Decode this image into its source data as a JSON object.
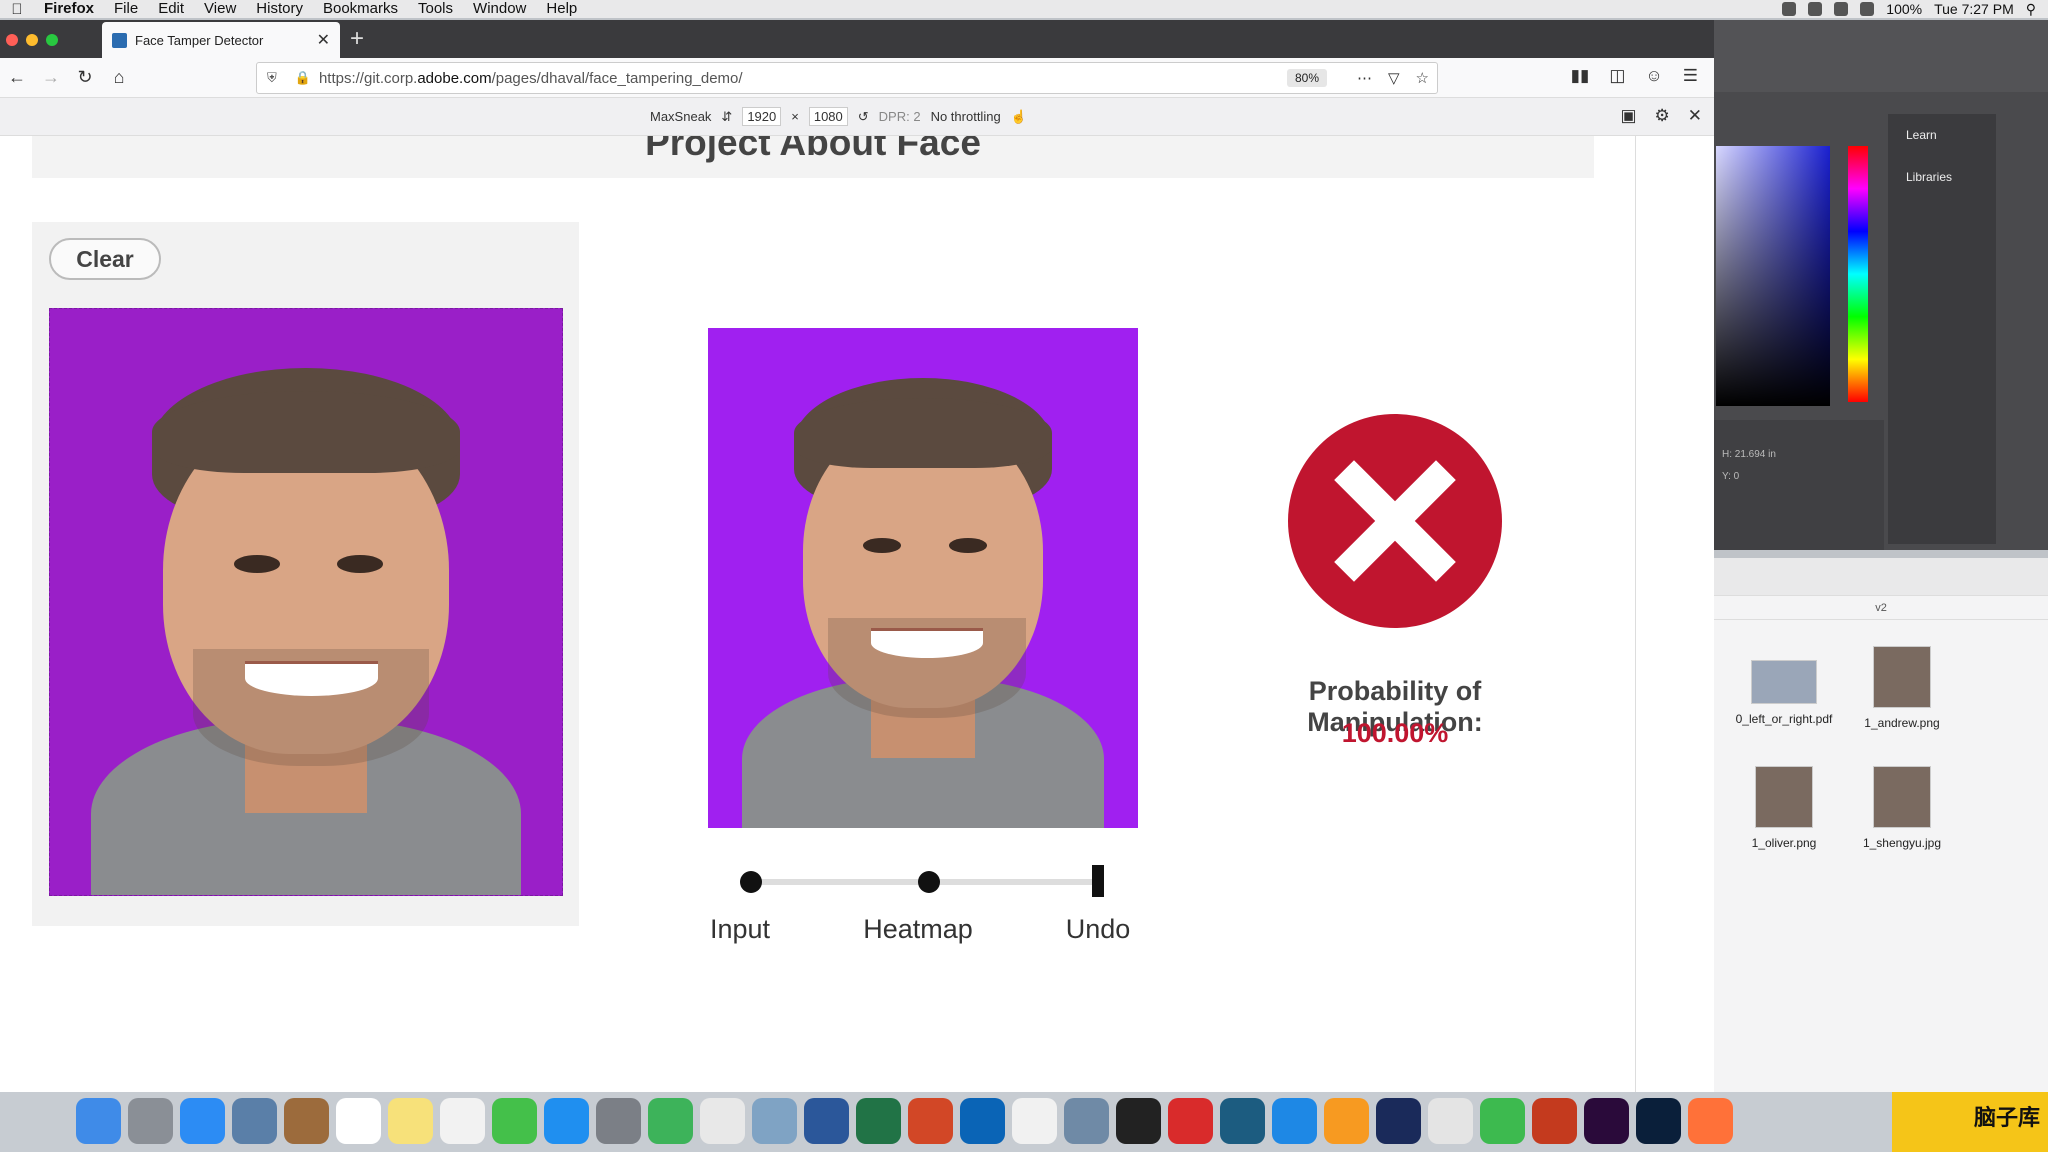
{
  "menubar": {
    "app": "Firefox",
    "items": [
      "File",
      "Edit",
      "View",
      "History",
      "Bookmarks",
      "Tools",
      "Window",
      "Help"
    ],
    "battery": "100%",
    "clock": "Tue 7:27 PM"
  },
  "browser": {
    "tab_title": "Face Tamper Detector",
    "url_prefix": "https://git.corp.",
    "url_domain": "adobe.com",
    "url_path": "/pages/dhaval/face_tampering_demo/",
    "zoom": "80%",
    "rdm": {
      "device": "MaxSneak",
      "width": "1920",
      "height": "1080",
      "dpr": "DPR: 2",
      "throttling": "No throttling"
    }
  },
  "page": {
    "title": "Project About Face",
    "clear_label": "Clear",
    "slider": {
      "steps": [
        "Input",
        "Heatmap",
        "Undo"
      ],
      "active_index": 2
    },
    "result": {
      "label": "Probability of Manipulation:",
      "value": "100.00%",
      "icon": "x-circle-icon",
      "color": "#c0152f"
    }
  },
  "photoshop": {
    "panel_items": [
      "Learn",
      "Libraries"
    ],
    "props": [
      "H: 21.694 in",
      "Y: 0"
    ]
  },
  "finder": {
    "folder": "v2",
    "files": [
      "0_left_or_right.pdf",
      "1_andrew.png",
      "1_oliver.png",
      "1_shengyu.jpg"
    ]
  },
  "watermark": "脑子库"
}
